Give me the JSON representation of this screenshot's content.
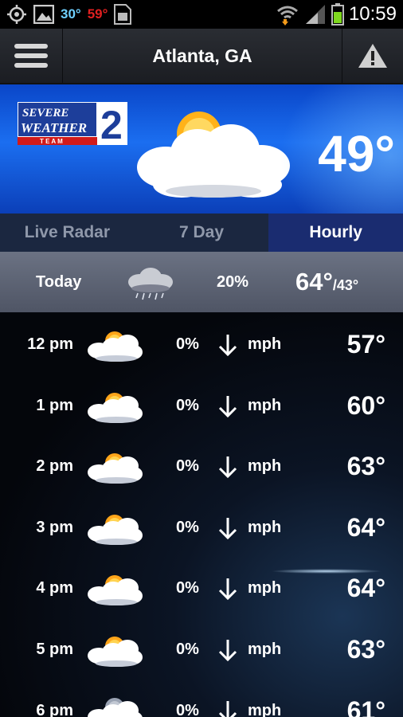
{
  "status_bar": {
    "temp_current": "30°",
    "temp_high": "59°",
    "time": "10:59"
  },
  "header": {
    "city": "Atlanta, GA"
  },
  "current": {
    "logo_text": "Severe Weather 2 Team",
    "temp": "49°"
  },
  "tabs": [
    {
      "label": "Live Radar",
      "active": false
    },
    {
      "label": "7 Day",
      "active": false
    },
    {
      "label": "Hourly",
      "active": true
    }
  ],
  "today": {
    "label": "Today",
    "precip": "20%",
    "high": "64°",
    "low": "/43°",
    "icon": "rain-cloud-icon"
  },
  "hourly": [
    {
      "hour": "12 pm",
      "precip": "0%",
      "wind": "mph",
      "temp": "57°",
      "icon": "partly-cloudy-icon"
    },
    {
      "hour": "1 pm",
      "precip": "0%",
      "wind": "mph",
      "temp": "60°",
      "icon": "partly-cloudy-icon"
    },
    {
      "hour": "2 pm",
      "precip": "0%",
      "wind": "mph",
      "temp": "63°",
      "icon": "partly-cloudy-icon"
    },
    {
      "hour": "3 pm",
      "precip": "0%",
      "wind": "mph",
      "temp": "64°",
      "icon": "partly-cloudy-icon"
    },
    {
      "hour": "4 pm",
      "precip": "0%",
      "wind": "mph",
      "temp": "64°",
      "icon": "partly-cloudy-icon"
    },
    {
      "hour": "5 pm",
      "precip": "0%",
      "wind": "mph",
      "temp": "63°",
      "icon": "partly-cloudy-icon"
    },
    {
      "hour": "6 pm",
      "precip": "0%",
      "wind": "mph",
      "temp": "61°",
      "icon": "partly-cloudy-night-icon"
    }
  ],
  "colors": {
    "accent_blue": "#1a2c70",
    "hero_blue": "#1b6ef0",
    "logo_red": "#d11a1a"
  }
}
